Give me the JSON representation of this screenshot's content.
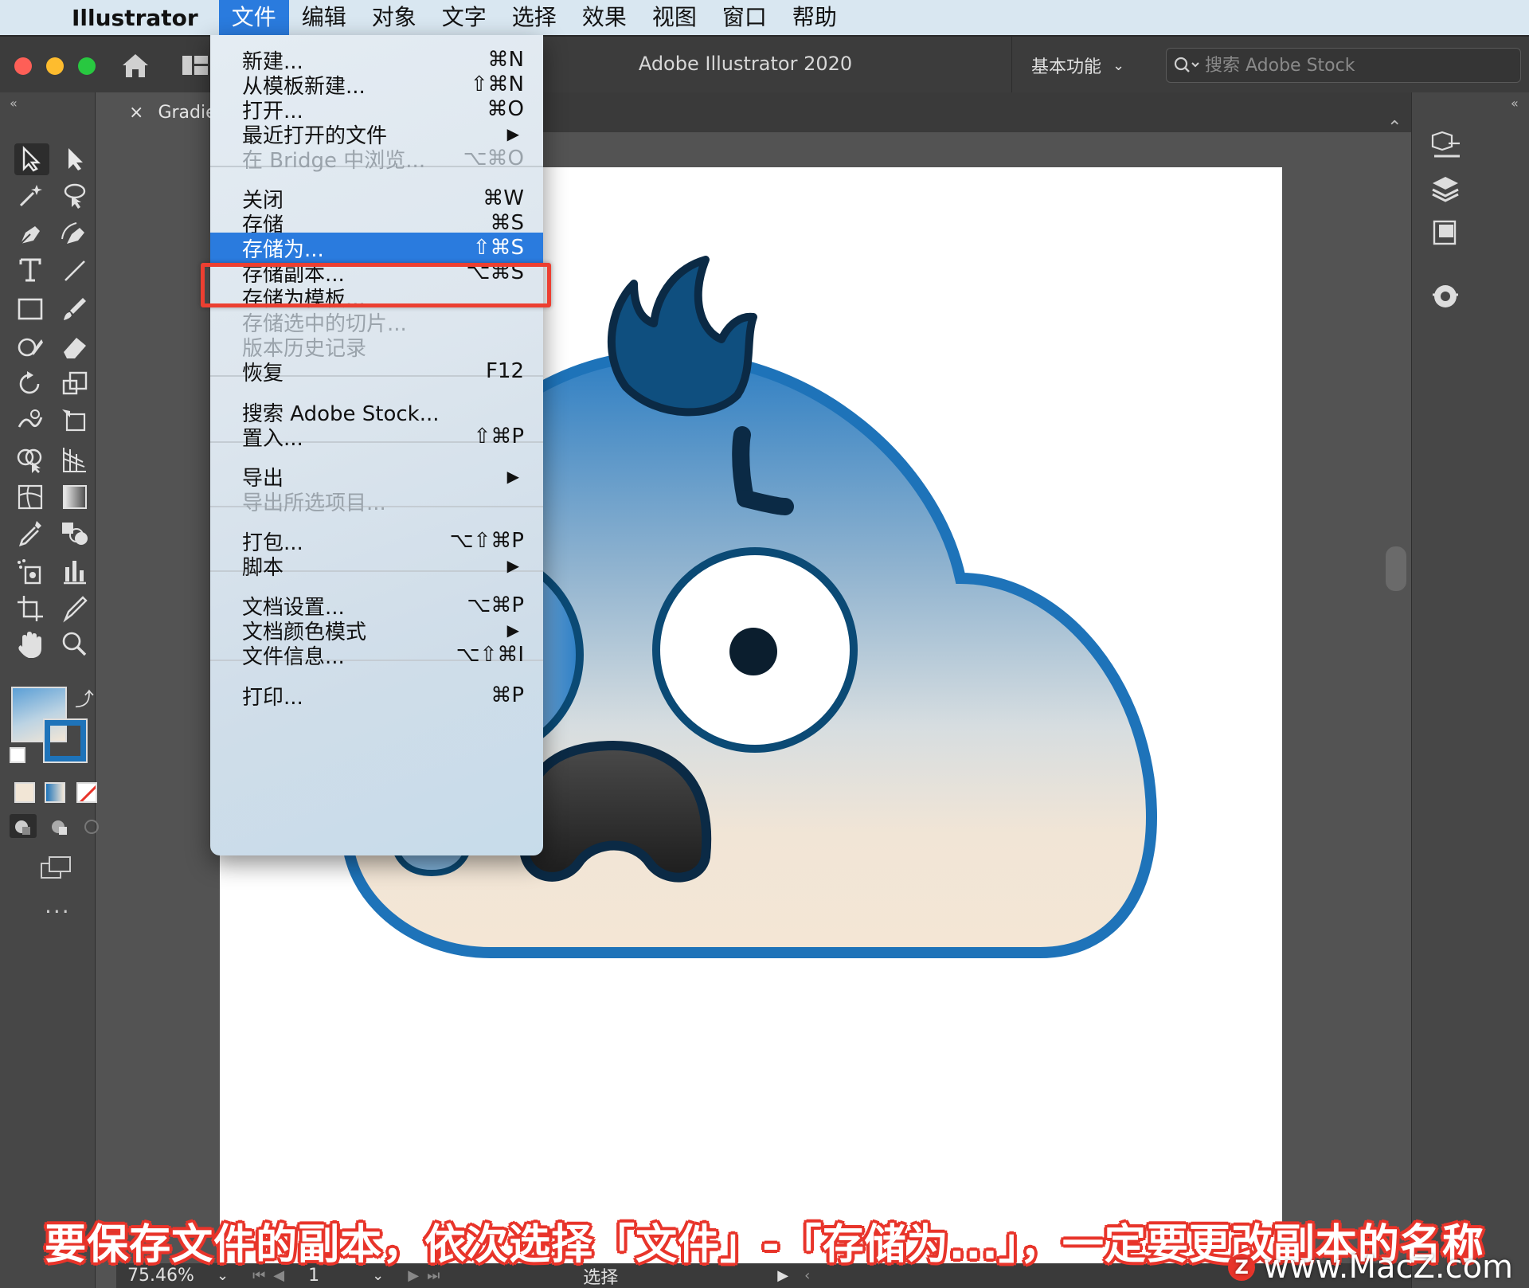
{
  "menubar": {
    "app_name": "Illustrator",
    "items": [
      "文件",
      "编辑",
      "对象",
      "文字",
      "选择",
      "效果",
      "视图",
      "窗口",
      "帮助"
    ],
    "active_index": 0
  },
  "titlebar": {
    "title": "Adobe Illustrator 2020",
    "workspace": "基本功能",
    "stock_search_placeholder": "搜索 Adobe Stock"
  },
  "document_tab": {
    "name": "Gradie",
    "close": "×"
  },
  "file_menu": {
    "items": [
      {
        "label": "新建...",
        "shortcut": "⌘N",
        "disabled": false
      },
      {
        "label": "从模板新建...",
        "shortcut": "⇧⌘N",
        "disabled": false
      },
      {
        "label": "打开...",
        "shortcut": "⌘O",
        "disabled": false
      },
      {
        "label": "最近打开的文件",
        "shortcut": "▶",
        "disabled": false
      },
      {
        "label": "在 Bridge 中浏览...",
        "shortcut": "⌥⌘O",
        "disabled": true
      },
      {
        "label": "关闭",
        "shortcut": "⌘W",
        "disabled": false
      },
      {
        "label": "存储",
        "shortcut": "⌘S",
        "disabled": false
      },
      {
        "label": "存储为...",
        "shortcut": "⇧⌘S",
        "disabled": false
      },
      {
        "label": "存储副本...",
        "shortcut": "⌥⌘S",
        "disabled": false
      },
      {
        "label": "存储为模板...",
        "shortcut": "",
        "disabled": false
      },
      {
        "label": "存储选中的切片...",
        "shortcut": "",
        "disabled": true
      },
      {
        "label": "版本历史记录",
        "shortcut": "",
        "disabled": true
      },
      {
        "label": "恢复",
        "shortcut": "F12",
        "disabled": false
      },
      {
        "label": "搜索 Adobe Stock...",
        "shortcut": "",
        "disabled": false
      },
      {
        "label": "置入...",
        "shortcut": "⇧⌘P",
        "disabled": false
      },
      {
        "label": "导出",
        "shortcut": "▶",
        "disabled": false
      },
      {
        "label": "导出所选项目...",
        "shortcut": "",
        "disabled": true
      },
      {
        "label": "打包...",
        "shortcut": "⌥⇧⌘P",
        "disabled": false
      },
      {
        "label": "脚本",
        "shortcut": "▶",
        "disabled": false
      },
      {
        "label": "文档设置...",
        "shortcut": "⌥⌘P",
        "disabled": false
      },
      {
        "label": "文档颜色模式",
        "shortcut": "▶",
        "disabled": false
      },
      {
        "label": "文件信息...",
        "shortcut": "⌥⇧⌘I",
        "disabled": false
      },
      {
        "label": "打印...",
        "shortcut": "⌘P",
        "disabled": false
      }
    ],
    "highlighted_label": "存储为..."
  },
  "statusbar": {
    "zoom": "75.46%",
    "page": "1",
    "tool": "选择"
  },
  "caption": "要保存文件的副本，依次选择「文件」-「存储为...」，一定要更改副本的名称",
  "watermark": "www.MacZ.com",
  "colors": {
    "menu_highlight": "#2a7bde",
    "callout_red": "#ec3f31",
    "character_blue": "#1e73b9",
    "character_dark": "#0b2a45"
  }
}
